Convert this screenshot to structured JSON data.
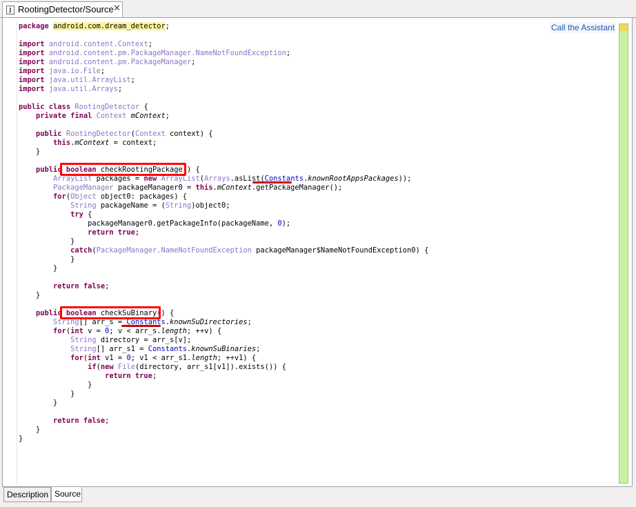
{
  "editor_tab": {
    "title": "RootingDetector/Source",
    "close_glyph": "✕",
    "icon": "java-file-icon"
  },
  "assistant_link": "Call the Assistant",
  "bottom_tabs": [
    {
      "label": "Description",
      "active": false
    },
    {
      "label": "Source",
      "active": true
    }
  ],
  "colors": {
    "keyword": "#7f0055",
    "type": "#8c74c8",
    "field": "#0000c0",
    "annotation": "#ff0000",
    "overview_ruler": "#c8f0a0"
  },
  "code_lines": [
    [
      [
        "k",
        "package"
      ],
      [
        "",
        " "
      ],
      [
        "pkgname",
        "android.com.dream_detector"
      ],
      [
        "",
        ";"
      ]
    ],
    [],
    [
      [
        "k",
        "import"
      ],
      [
        "",
        " "
      ],
      [
        "t",
        "android.content.Context"
      ],
      [
        "",
        ";"
      ]
    ],
    [
      [
        "k",
        "import"
      ],
      [
        "",
        " "
      ],
      [
        "t",
        "android.content.pm.PackageManager.NameNotFoundException"
      ],
      [
        "",
        ";"
      ]
    ],
    [
      [
        "k",
        "import"
      ],
      [
        "",
        " "
      ],
      [
        "t",
        "android.content.pm.PackageManager"
      ],
      [
        "",
        ";"
      ]
    ],
    [
      [
        "k",
        "import"
      ],
      [
        "",
        " "
      ],
      [
        "t",
        "java.io.File"
      ],
      [
        "",
        ";"
      ]
    ],
    [
      [
        "k",
        "import"
      ],
      [
        "",
        " "
      ],
      [
        "t",
        "java.util.ArrayList"
      ],
      [
        "",
        ";"
      ]
    ],
    [
      [
        "k",
        "import"
      ],
      [
        "",
        " "
      ],
      [
        "t",
        "java.util.Arrays"
      ],
      [
        "",
        ";"
      ]
    ],
    [],
    [
      [
        "k",
        "public class"
      ],
      [
        "",
        " "
      ],
      [
        "t",
        "RootingDetector"
      ],
      [
        "",
        " {"
      ]
    ],
    [
      [
        "",
        "    "
      ],
      [
        "k",
        "private final"
      ],
      [
        "",
        " "
      ],
      [
        "t",
        "Context"
      ],
      [
        "",
        " "
      ],
      [
        "i",
        "mContext"
      ],
      [
        "",
        ";"
      ]
    ],
    [],
    [
      [
        "",
        "    "
      ],
      [
        "k",
        "public"
      ],
      [
        "",
        " "
      ],
      [
        "t",
        "RootingDetector"
      ],
      [
        "",
        "("
      ],
      [
        "t",
        "Context"
      ],
      [
        "",
        " context) {"
      ]
    ],
    [
      [
        "",
        "        "
      ],
      [
        "k",
        "this"
      ],
      [
        "",
        "."
      ],
      [
        "i",
        "mContext"
      ],
      [
        "",
        " = context;"
      ]
    ],
    [
      [
        "",
        "    }"
      ]
    ],
    [],
    [
      [
        "",
        "    "
      ],
      [
        "k",
        "public"
      ],
      [
        "",
        " "
      ],
      [
        "k",
        "boolean"
      ],
      [
        "",
        " checkRootingPackage() {"
      ]
    ],
    [
      [
        "",
        "        "
      ],
      [
        "t",
        "ArrayList"
      ],
      [
        "",
        " packages = "
      ],
      [
        "k",
        "new"
      ],
      [
        "",
        " "
      ],
      [
        "t",
        "ArrayList"
      ],
      [
        "",
        "("
      ],
      [
        "t",
        "Arrays"
      ],
      [
        "",
        ".asList("
      ],
      [
        "n",
        "Constants"
      ],
      [
        "",
        "."
      ],
      [
        "i",
        "knownRootAppsPackages"
      ],
      [
        "",
        "));"
      ]
    ],
    [
      [
        "",
        "        "
      ],
      [
        "t",
        "PackageManager"
      ],
      [
        "",
        " packageManager0 = "
      ],
      [
        "k",
        "this"
      ],
      [
        "",
        "."
      ],
      [
        "i",
        "mContext"
      ],
      [
        "",
        ".getPackageManager();"
      ]
    ],
    [
      [
        "",
        "        "
      ],
      [
        "k",
        "for"
      ],
      [
        "",
        "("
      ],
      [
        "t",
        "Object"
      ],
      [
        "",
        " object0: packages) {"
      ]
    ],
    [
      [
        "",
        "            "
      ],
      [
        "t",
        "String"
      ],
      [
        "",
        " packageName = ("
      ],
      [
        "t",
        "String"
      ],
      [
        "",
        ")object0;"
      ]
    ],
    [
      [
        "",
        "            "
      ],
      [
        "k",
        "try"
      ],
      [
        "",
        " {"
      ]
    ],
    [
      [
        "",
        "                packageManager0.getPackageInfo(packageName, "
      ],
      [
        "n",
        "0"
      ],
      [
        "",
        ");"
      ]
    ],
    [
      [
        "",
        "                "
      ],
      [
        "k",
        "return true"
      ],
      [
        "",
        ";"
      ]
    ],
    [
      [
        "",
        "            }"
      ]
    ],
    [
      [
        "",
        "            "
      ],
      [
        "k",
        "catch"
      ],
      [
        "",
        "("
      ],
      [
        "t",
        "PackageManager.NameNotFoundException"
      ],
      [
        "",
        " packageManager$NameNotFoundException0) {"
      ]
    ],
    [
      [
        "",
        "            }"
      ]
    ],
    [
      [
        "",
        "        }"
      ]
    ],
    [],
    [
      [
        "",
        "        "
      ],
      [
        "k",
        "return false"
      ],
      [
        "",
        ";"
      ]
    ],
    [
      [
        "",
        "    }"
      ]
    ],
    [],
    [
      [
        "",
        "    "
      ],
      [
        "k",
        "public"
      ],
      [
        "",
        " "
      ],
      [
        "k",
        "boolean"
      ],
      [
        "",
        " checkSuBinary() {"
      ]
    ],
    [
      [
        "",
        "        "
      ],
      [
        "t",
        "String"
      ],
      [
        "",
        "[] arr_s = "
      ],
      [
        "n",
        "Constants"
      ],
      [
        "",
        "."
      ],
      [
        "i",
        "knownSuDirectories"
      ],
      [
        "",
        ";"
      ]
    ],
    [
      [
        "",
        "        "
      ],
      [
        "k",
        "for"
      ],
      [
        "",
        "("
      ],
      [
        "k",
        "int"
      ],
      [
        "",
        " v = "
      ],
      [
        "n",
        "0"
      ],
      [
        "",
        "; v < arr_s."
      ],
      [
        "i",
        "length"
      ],
      [
        "",
        "; ++v) {"
      ]
    ],
    [
      [
        "",
        "            "
      ],
      [
        "t",
        "String"
      ],
      [
        "",
        " directory = arr_s[v];"
      ]
    ],
    [
      [
        "",
        "            "
      ],
      [
        "t",
        "String"
      ],
      [
        "",
        "[] arr_s1 = "
      ],
      [
        "n",
        "Constants"
      ],
      [
        "",
        "."
      ],
      [
        "i",
        "knownSuBinaries"
      ],
      [
        "",
        ";"
      ]
    ],
    [
      [
        "",
        "            "
      ],
      [
        "k",
        "for"
      ],
      [
        "",
        "("
      ],
      [
        "k",
        "int"
      ],
      [
        "",
        " v1 = "
      ],
      [
        "n",
        "0"
      ],
      [
        "",
        "; v1 < arr_s1."
      ],
      [
        "i",
        "length"
      ],
      [
        "",
        "; ++v1) {"
      ]
    ],
    [
      [
        "",
        "                "
      ],
      [
        "k",
        "if"
      ],
      [
        "",
        "("
      ],
      [
        "k",
        "new"
      ],
      [
        "",
        " "
      ],
      [
        "t",
        "File"
      ],
      [
        "",
        "(directory, arr_s1[v1]).exists()) {"
      ]
    ],
    [
      [
        "",
        "                    "
      ],
      [
        "k",
        "return true"
      ],
      [
        "",
        ";"
      ]
    ],
    [
      [
        "",
        "                }"
      ]
    ],
    [
      [
        "",
        "            }"
      ]
    ],
    [
      [
        "",
        "        }"
      ]
    ],
    [],
    [
      [
        "",
        "        "
      ],
      [
        "k",
        "return false"
      ],
      [
        "",
        ";"
      ]
    ],
    [
      [
        "",
        "    }"
      ]
    ],
    [
      [
        "",
        "}"
      ]
    ]
  ]
}
